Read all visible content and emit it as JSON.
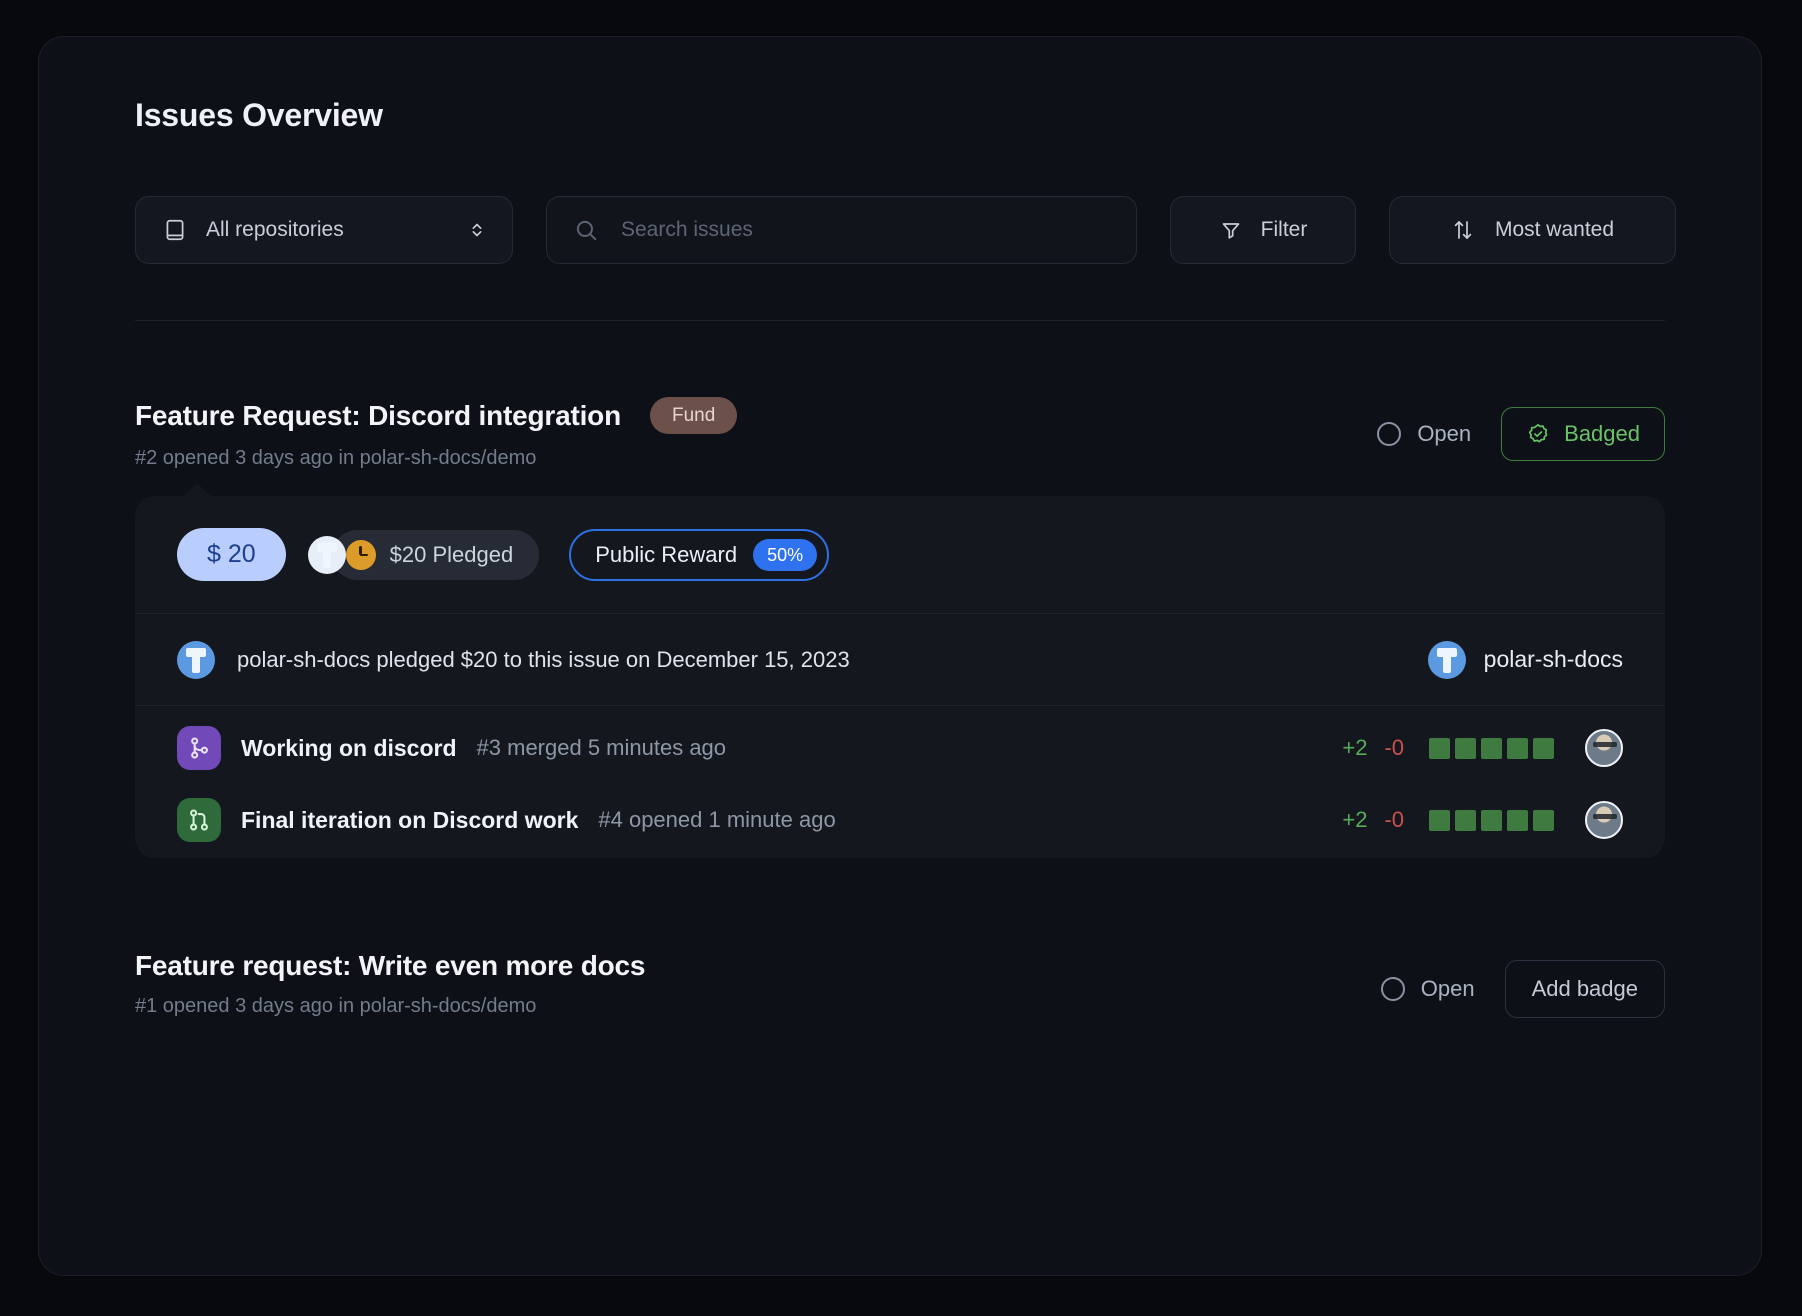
{
  "header": {
    "title": "Issues Overview"
  },
  "toolbar": {
    "repo_select": {
      "label": "All repositories",
      "icon": "book-icon",
      "caret": "chevron-updown-icon"
    },
    "search": {
      "placeholder": "Search issues",
      "value": "",
      "icon": "search-icon"
    },
    "filter_button": {
      "label": "Filter",
      "icon": "funnel-icon"
    },
    "sort_button": {
      "label": "Most wanted",
      "icon": "sort-updown-icon"
    }
  },
  "colors": {
    "background": "#07090d",
    "panel": "#0d1016",
    "card": "#14171e",
    "accent_blue": "#2f72ef",
    "amount_pill_bg": "#b9cefc",
    "amount_pill_text": "#1e3f8f",
    "badged_green": "#69c267",
    "fund_badge_bg": "#6b5149",
    "additions_green": "#57ab5a",
    "deletions_red": "#c9534a",
    "diff_square": "#3f7a41",
    "merged_purple": "#7249b8",
    "pr_open_green": "#2f6b3a"
  },
  "issues": [
    {
      "title": "Feature Request: Discord integration",
      "fund_badge": "Fund",
      "meta": "#2 opened 3 days ago in polar-sh-docs/demo",
      "state_label": "Open",
      "state_icon": "open-circle-icon",
      "badge_button": {
        "label": "Badged",
        "icon": "verified-check-icon",
        "style": "badged"
      },
      "card": {
        "amount_pill": "$ 20",
        "pledged_pill": {
          "label": "$20 Pledged",
          "icon": "clock-icon",
          "avatar": "polar-sh-docs-avatar"
        },
        "reward_pill": {
          "label": "Public Reward",
          "percent": "50%"
        },
        "pledge_event": {
          "text": "polar-sh-docs pledged $20 to this issue on December 15, 2023",
          "avatar": "polar-sh-docs-avatar",
          "org_name": "polar-sh-docs",
          "org_avatar": "polar-sh-docs-avatar"
        },
        "pull_requests": [
          {
            "title": "Working on discord",
            "meta": "#3 merged 5 minutes ago",
            "icon": "git-merge-icon",
            "state": "merged",
            "additions": "+2",
            "deletions": "-0",
            "diff_squares": 5,
            "author_avatar": "author-avatar"
          },
          {
            "title": "Final iteration on Discord work",
            "meta": "#4 opened 1 minute ago",
            "icon": "git-pull-request-icon",
            "state": "open",
            "additions": "+2",
            "deletions": "-0",
            "diff_squares": 5,
            "author_avatar": "author-avatar"
          }
        ]
      }
    },
    {
      "title": "Feature request: Write even more docs",
      "meta": "#1 opened 3 days ago in polar-sh-docs/demo",
      "state_label": "Open",
      "state_icon": "open-circle-icon",
      "badge_button": {
        "label": "Add badge",
        "style": "outline"
      }
    }
  ]
}
